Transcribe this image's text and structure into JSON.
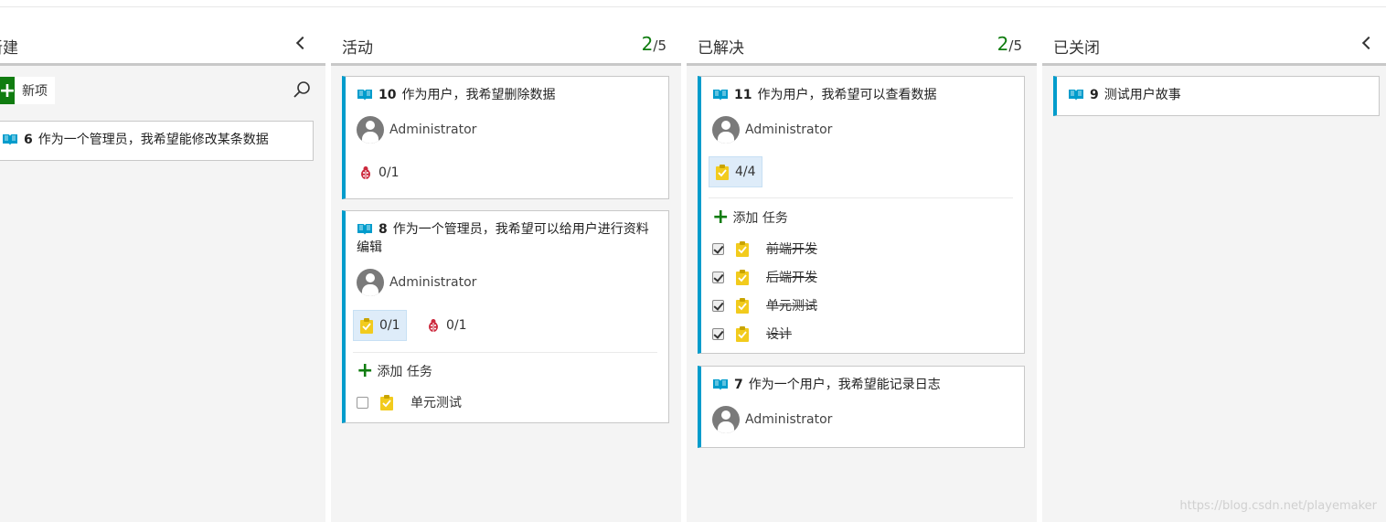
{
  "columns": [
    {
      "title": "新建",
      "new_item_label": "新项",
      "cards": [
        {
          "id": "6",
          "title": "作为一个管理员，我希望能修改某条数据"
        }
      ]
    },
    {
      "title": "活动",
      "count": "2",
      "limit": "/5",
      "cards": [
        {
          "id": "10",
          "title": "作为用户，我希望删除数据",
          "assignee": "Administrator",
          "bugs": "0/1"
        },
        {
          "id": "8",
          "title": "作为一个管理员，我希望可以给用户进行资料编辑",
          "assignee": "Administrator",
          "tasks_rollup": "0/1",
          "bugs": "0/1",
          "add_task_label": "添加 任务",
          "tasks": [
            {
              "title": "单元测试",
              "done": false
            }
          ]
        }
      ]
    },
    {
      "title": "已解决",
      "count": "2",
      "limit": "/5",
      "cards": [
        {
          "id": "11",
          "title": "作为用户，我希望可以查看数据",
          "assignee": "Administrator",
          "tasks_rollup": "4/4",
          "add_task_label": "添加 任务",
          "tasks": [
            {
              "title": "前端开发",
              "done": true
            },
            {
              "title": "后端开发",
              "done": true
            },
            {
              "title": "单元测试",
              "done": true
            },
            {
              "title": "设计",
              "done": true
            }
          ]
        },
        {
          "id": "7",
          "title": "作为一个用户，我希望能记录日志",
          "assignee": "Administrator"
        }
      ]
    },
    {
      "title": "已关闭",
      "cards": [
        {
          "id": "9",
          "title": "测试用户故事"
        }
      ]
    }
  ],
  "watermark": "https://blog.csdn.net/playemaker",
  "colors": {
    "accent": "#009ccc",
    "count_green": "#107c10",
    "bug_red": "#cc293d",
    "task_yellow": "#f2cb1d"
  },
  "icons": [
    "story-book-icon",
    "avatar-icon",
    "bug-icon",
    "task-clipboard-icon",
    "plus-icon",
    "search-icon",
    "chevron-left-icon",
    "checkbox-icon"
  ]
}
